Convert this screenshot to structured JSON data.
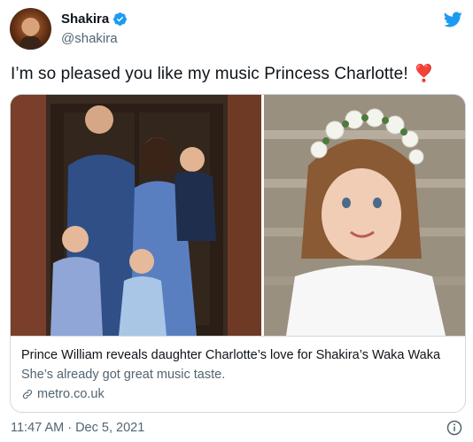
{
  "user": {
    "name": "Shakira",
    "handle": "@shakira"
  },
  "tweet": {
    "text": "I’m so pleased you like my music Princess Charlotte!",
    "emoji": "❣️",
    "timestamp": "11:47 AM · Dec 5, 2021"
  },
  "card": {
    "title": "Prince William reveals daughter Charlotte’s love for Shakira’s Waka Waka",
    "description": "She’s already got great music taste.",
    "domain": "metro.co.uk"
  },
  "icons": {
    "verified": "verified-badge-icon",
    "logo": "twitter-bird-icon",
    "link": "link-icon",
    "info": "info-icon"
  },
  "colors": {
    "brand": "#1d9bf0",
    "text": "#0f1419",
    "secondary": "#536471",
    "heart": "#dd2e44"
  }
}
